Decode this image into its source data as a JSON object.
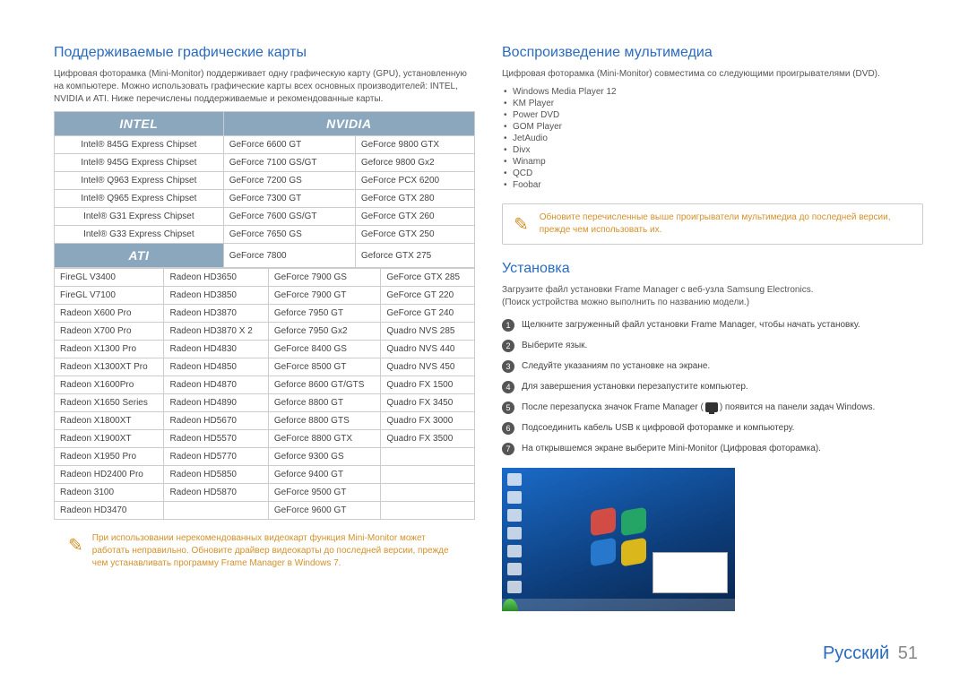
{
  "left": {
    "heading": "Поддерживаемые графические карты",
    "intro": "Цифровая фоторамка (Mini-Monitor) поддерживает одну графическую карту (GPU), установленную на компьютере. Можно использовать графические карты всех основных производителей: INTEL, NVIDIA и ATI. Ниже перечислены поддерживаемые и рекомендованные карты.",
    "brands": {
      "intel": "INTEL",
      "nvidia": "NVIDIA",
      "ati": "ATI"
    },
    "table": {
      "section1": [
        [
          "Intel® 845G Express Chipset",
          "GeForce 6600 GT",
          "GeForce 9800 GTX"
        ],
        [
          "Intel® 945G Express Chipset",
          "GeForce 7100 GS/GT",
          "Geforce 9800 Gx2"
        ],
        [
          "Intel® Q963 Express Chipset",
          "GeForce 7200 GS",
          "GeForce PCX 6200"
        ],
        [
          "Intel® Q965 Express Chipset",
          "GeForce 7300 GT",
          "GeForce GTX 280"
        ],
        [
          "Intel® G31 Express Chipset",
          "GeForce 7600 GS/GT",
          "GeForce GTX 260"
        ],
        [
          "Intel® G33 Express Chipset",
          "GeForce 7650 GS",
          "GeForce GTX 250"
        ]
      ],
      "section2_first": [
        "",
        "GeForce 7800",
        "Geforce GTX 275"
      ],
      "section2": [
        [
          "FireGL V3400",
          "Radeon HD3650",
          "GeForce 7900 GS",
          "GeForce GTX 285"
        ],
        [
          "FireGL V7100",
          "Radeon HD3850",
          "GeForce 7900 GT",
          "GeForce GT 220"
        ],
        [
          "Radeon X600 Pro",
          "Radeon HD3870",
          "Geforce 7950 GT",
          "GeForce GT 240"
        ],
        [
          "Radeon X700 Pro",
          "Radeon HD3870 X 2",
          "Geforce 7950 Gx2",
          "Quadro NVS 285"
        ],
        [
          "Radeon X1300 Pro",
          "Radeon HD4830",
          "GeForce 8400 GS",
          "Quadro NVS 440"
        ],
        [
          "Radeon X1300XT Pro",
          "Radeon HD4850",
          "GeForce 8500 GT",
          "Quadro NVS 450"
        ],
        [
          "Radeon X1600Pro",
          "Radeon HD4870",
          "Geforce 8600 GT/GTS",
          "Quadro FX 1500"
        ],
        [
          "Radeon X1650 Series",
          "Radeon HD4890",
          "Geforce 8800 GT",
          "Quadro FX 3450"
        ],
        [
          "Radeon X1800XT",
          "Radeon HD5670",
          "Geforce 8800 GTS",
          "Quadro FX 3000"
        ],
        [
          "Radeon X1900XT",
          "Radeon HD5570",
          "GeForce 8800 GTX",
          "Quadro FX 3500"
        ],
        [
          "Radeon X1950 Pro",
          "Radeon HD5770",
          "Geforce 9300 GS",
          ""
        ],
        [
          "Radeon HD2400 Pro",
          "Radeon HD5850",
          "Geforce 9400 GT",
          ""
        ],
        [
          "Radeon 3100",
          "Radeon HD5870",
          "GeForce 9500 GT",
          ""
        ],
        [
          "Radeon HD3470",
          "",
          "GeForce 9600 GT",
          ""
        ]
      ]
    },
    "note": "При использовании нерекомендованных видеокарт функция Mini-Monitor может работать неправильно. Обновите драйвер видеокарты до последней версии, прежде чем устанавливать программу Frame Manager в Windows 7."
  },
  "right": {
    "h_media": "Воспроизведение мультимедиа",
    "media_intro": "Цифровая фоторамка (Mini-Monitor) совместима со следующими проигрывателями (DVD).",
    "players": [
      "Windows Media Player 12",
      "KM Player",
      "Power DVD",
      "GOM Player",
      "JetAudio",
      "Divx",
      "Winamp",
      "QCD",
      "Foobar"
    ],
    "media_note": "Обновите перечисленные выше проигрыватели мультимедиа до последней версии, прежде чем использовать их.",
    "h_install": "Установка",
    "install_intro1": "Загрузите файл установки Frame Manager с веб-узла Samsung Electronics.",
    "install_intro2": "(Поиск устройства можно выполнить по названию модели.)",
    "steps": [
      "Щелкните загруженный файл установки Frame Manager, чтобы начать установку.",
      "Выберите язык.",
      "Следуйте указаниям по установке на экране.",
      "Для завершения установки перезапустите компьютер.",
      "После перезапуска значок Frame Manager (",
      "Подсоединить кабель USB к цифровой фоторамке и компьютеру.",
      "На открывшемся экране выберите Mini-Monitor (Цифровая фоторамка)."
    ],
    "step5_tail": ") появится на панели задач Windows."
  },
  "footer": {
    "lang": "Русский",
    "page": "51"
  }
}
